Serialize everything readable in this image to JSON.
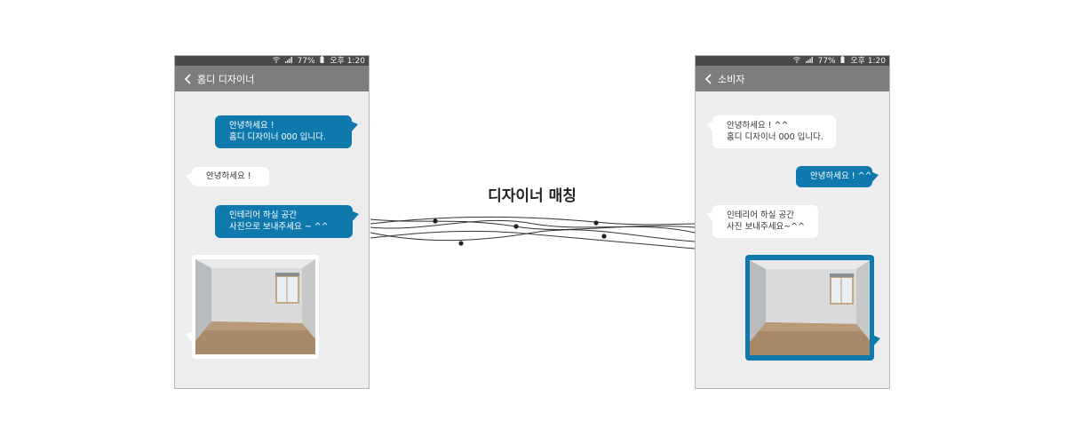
{
  "colors": {
    "sent_bubble": "#0f79ad",
    "received_bubble": "#ffffff",
    "app_bar": "#7d7d7b",
    "status_bar": "#4a4a4a",
    "chat_background": "#ededed"
  },
  "match_label": "디자이너 매칭",
  "left_phone": {
    "status": {
      "icons": "wifi-icon signal-icon",
      "battery": "77%",
      "time": "오후 1:20"
    },
    "title": "홈디 디자이너",
    "messages": [
      {
        "side": "sent",
        "lines": [
          "안녕하세요 !",
          "홈디 디자이너 000 입니다."
        ]
      },
      {
        "side": "received",
        "lines": [
          "안녕하세요 !"
        ]
      },
      {
        "side": "sent",
        "lines": [
          "인테리어 하실 공간",
          "사진으로 보내주세요 ~ ^^"
        ]
      },
      {
        "side": "received",
        "type": "photo",
        "icon": "empty-room-photo"
      }
    ]
  },
  "right_phone": {
    "status": {
      "icons": "wifi-icon signal-icon",
      "battery": "77%",
      "time": "오후 1:20"
    },
    "title": "소비자",
    "messages": [
      {
        "side": "received",
        "lines": [
          "안녕하세요 ! ^^",
          "홈디 디자이너 000 입니다."
        ]
      },
      {
        "side": "sent",
        "lines": [
          "안녕하세요 ! ^^"
        ]
      },
      {
        "side": "received",
        "lines": [
          "인테리어 하실 공간",
          "사진 보내주세요~^^"
        ]
      },
      {
        "side": "sent",
        "type": "photo",
        "icon": "empty-room-photo"
      }
    ]
  }
}
